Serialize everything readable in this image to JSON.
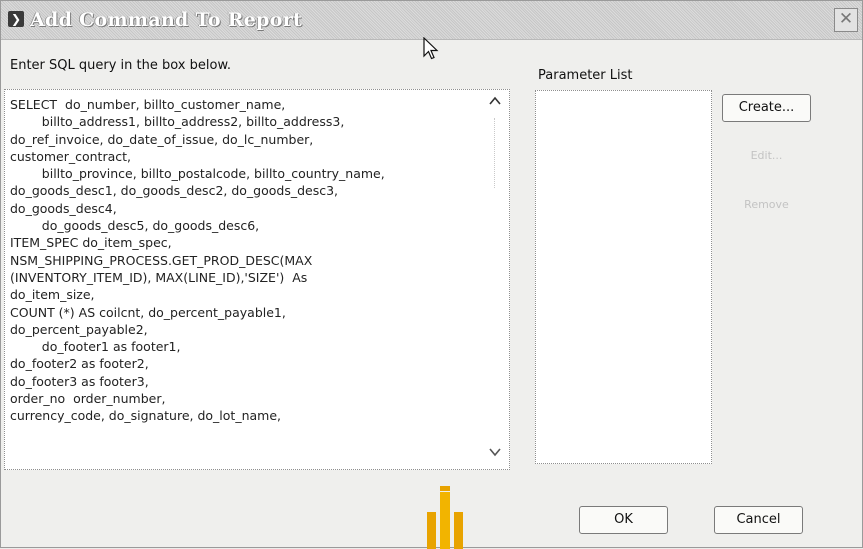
{
  "window": {
    "title": "Add Command To Report",
    "close_glyph": "✕"
  },
  "instruction": "Enter SQL query in the box below.",
  "sql_query_lines": [
    "SELECT  do_number, billto_customer_name,",
    "        billto_address1, billto_address2, billto_address3,",
    "do_ref_invoice, do_date_of_issue, do_lc_number,",
    "customer_contract,",
    "        billto_province, billto_postalcode, billto_country_name,",
    "do_goods_desc1, do_goods_desc2, do_goods_desc3,",
    "do_goods_desc4,",
    "        do_goods_desc5, do_goods_desc6,",
    "ITEM_SPEC do_item_spec,",
    "NSM_SHIPPING_PROCESS.GET_PROD_DESC(MAX",
    "(INVENTORY_ITEM_ID), MAX(LINE_ID),'SIZE')  As",
    "do_item_size,",
    "COUNT (*) AS coilcnt, do_percent_payable1,",
    "do_percent_payable2,",
    "        do_footer1 as footer1,",
    "do_footer2 as footer2,",
    "do_footer3 as footer3,",
    "order_no  order_number,",
    "currency_code, do_signature, do_lot_name,"
  ],
  "parameter_list": {
    "label": "Parameter List",
    "items": []
  },
  "buttons": {
    "create": "Create...",
    "edit": "Edit...",
    "remove": "Remove",
    "ok": "OK",
    "cancel": "Cancel"
  },
  "colors": {
    "title_text": "#ffffff",
    "disabled_text": "#c3c3c3",
    "watermark": "#e8a300"
  },
  "icons": {
    "title": "dialog-icon",
    "close": "close-icon",
    "cursor": "mouse-pointer-icon",
    "scroll_up": "scroll-up-icon",
    "scroll_down": "scroll-down-icon"
  }
}
